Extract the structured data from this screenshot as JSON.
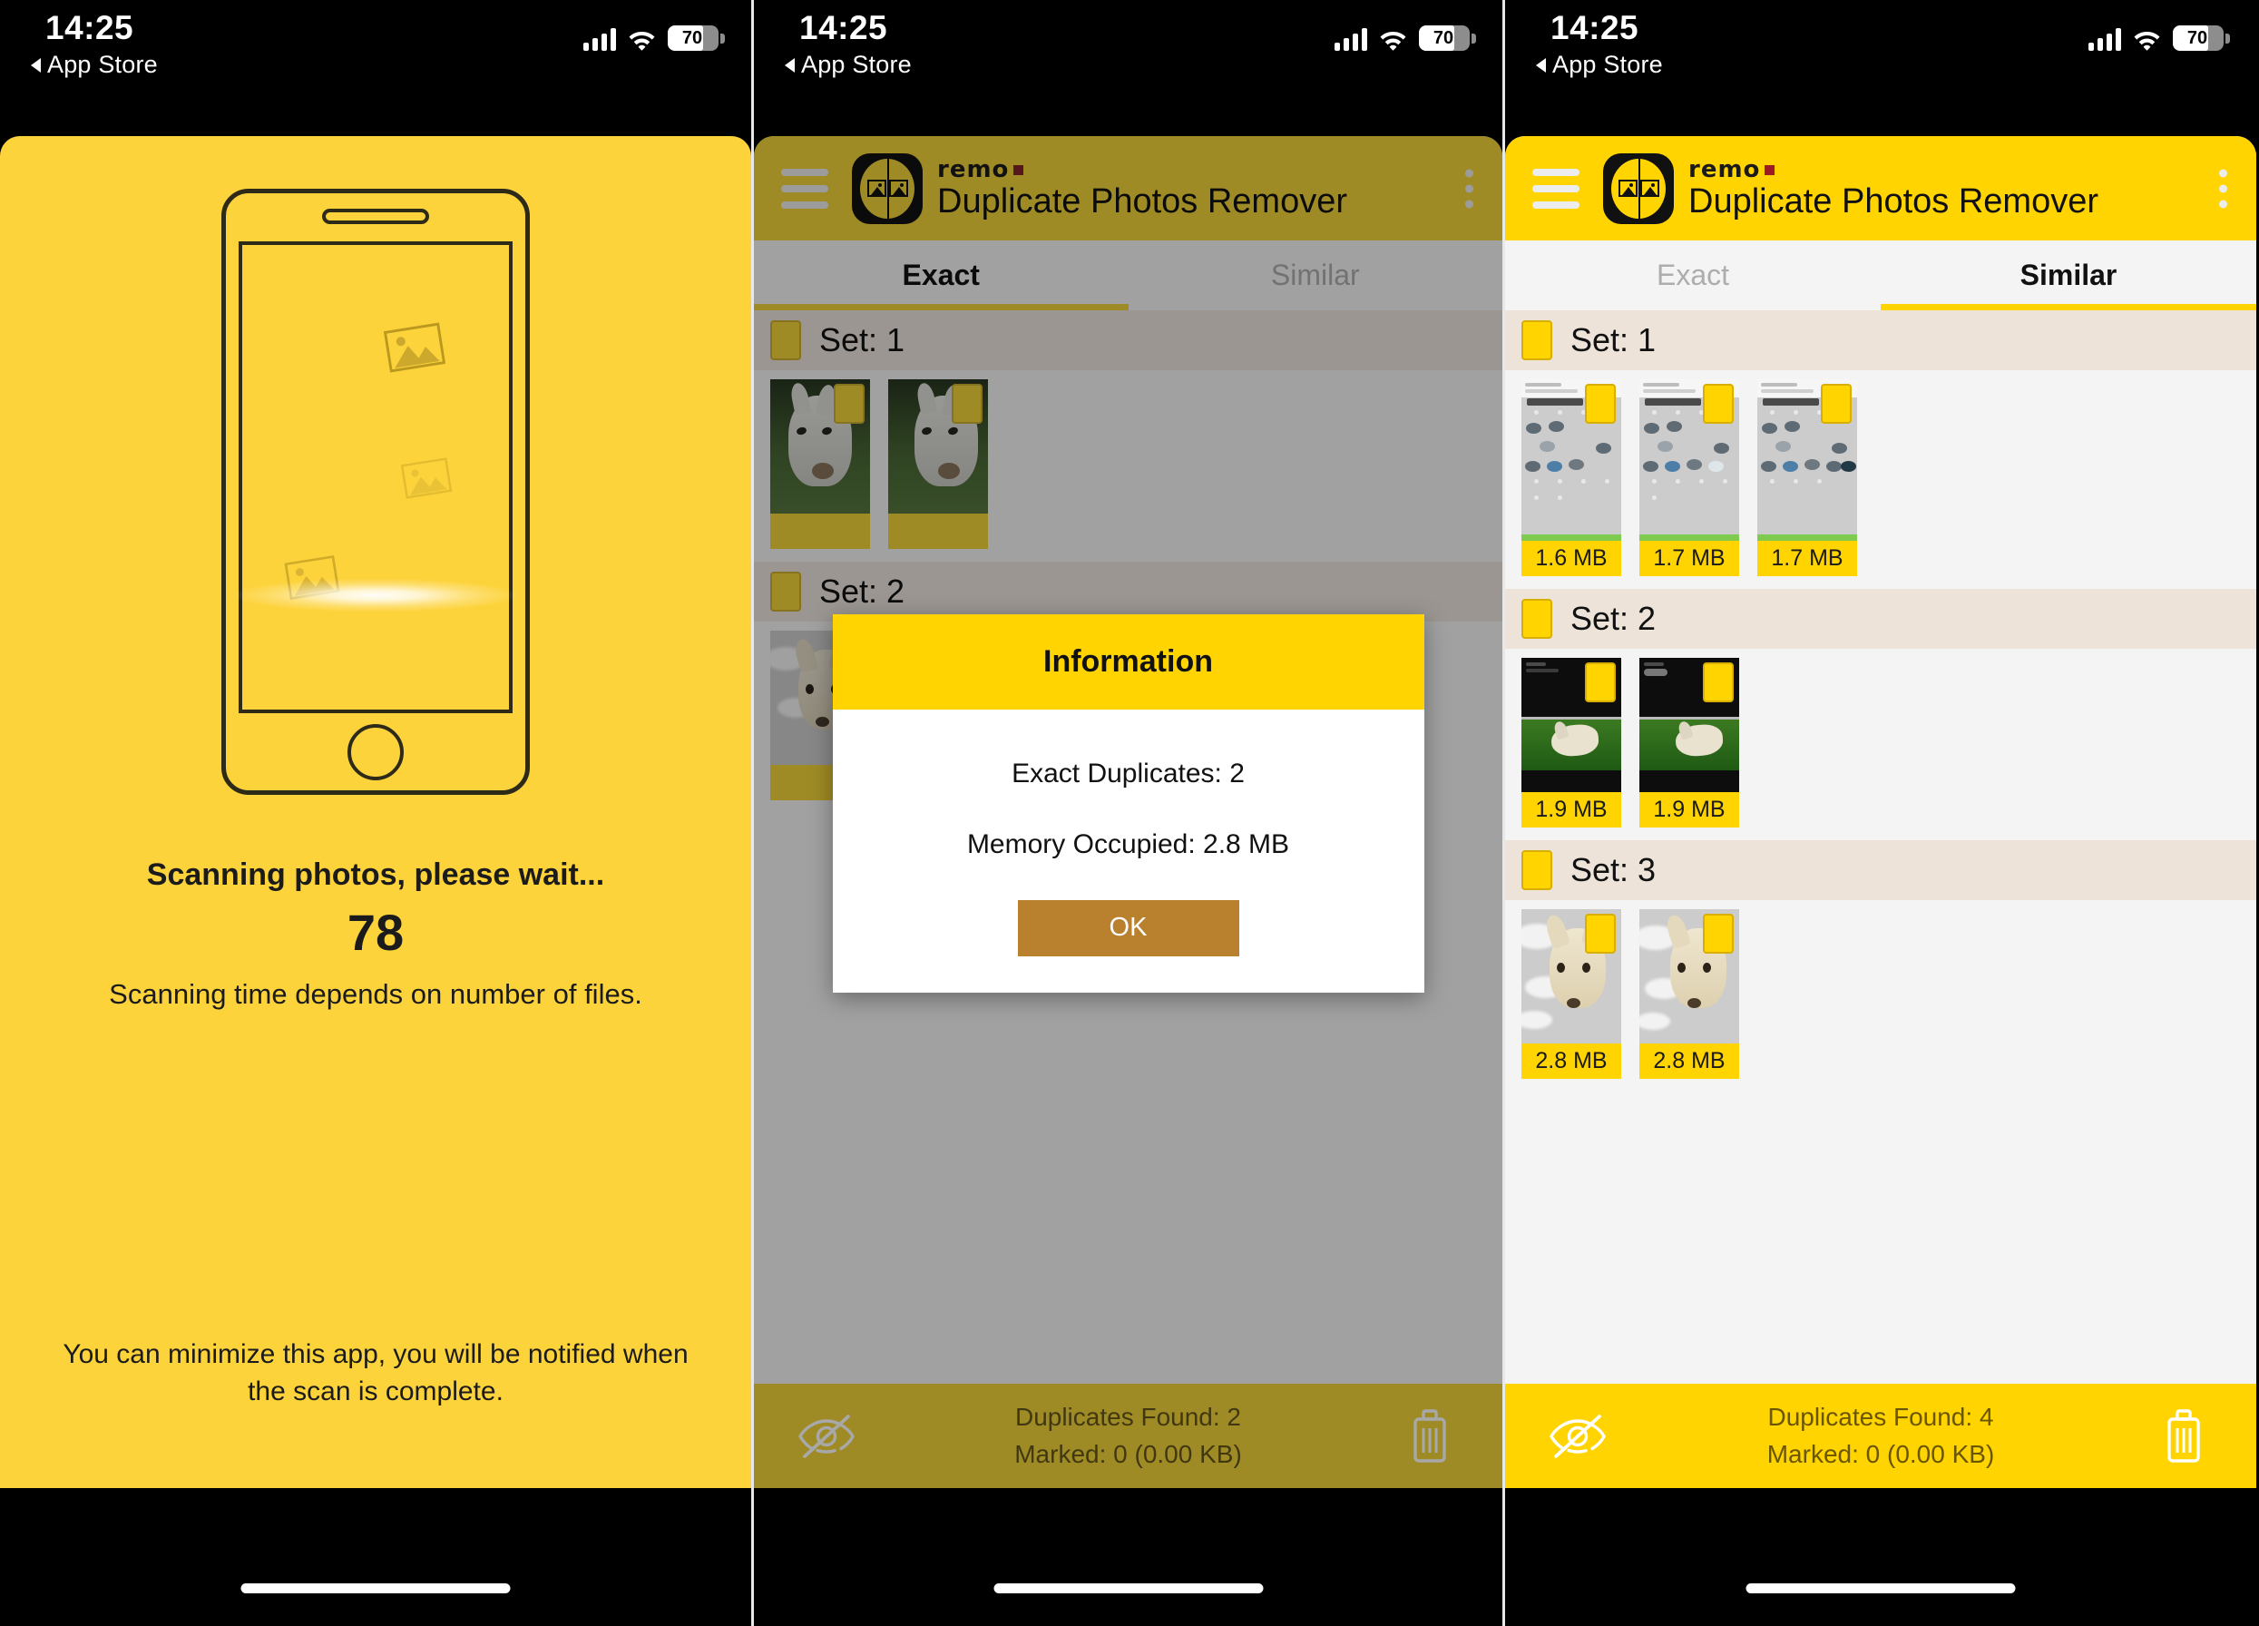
{
  "colors": {
    "brand_yellow": "#FFD400",
    "scan_yellow": "#FDD33C",
    "set_header_bg": "#EDE3D8",
    "list_bg": "#F4F4F4",
    "ok_button": "#B9802E",
    "remo_dot": "#9E1B25"
  },
  "status_bar": {
    "time": "14:25",
    "back_label": "App Store",
    "back_icon": "triangle-left-icon",
    "signal_icon": "cellular-signal-icon",
    "wifi_icon": "wifi-icon",
    "battery_icon": "battery-icon",
    "battery_level": "70"
  },
  "panel1": {
    "illustration": {
      "name": "phone-scanning-illustration",
      "photo_icon": "image-placeholder-icon",
      "beam": "scan-beam"
    },
    "scanning_title": "Scanning photos, please wait...",
    "scanned_count": "78",
    "scanning_subtitle": "Scanning time depends on number of files.",
    "footer_note": "You can minimize this app, you will be notified when the scan is complete."
  },
  "app": {
    "menu_icon": "hamburger-menu-icon",
    "logo_icon": "remo-app-logo-icon",
    "brand": "remo",
    "title": "Duplicate Photos Remover",
    "overflow_icon": "kebab-menu-icon",
    "tabs": [
      {
        "label": "Exact"
      },
      {
        "label": "Similar"
      }
    ]
  },
  "panel2": {
    "active_tab": "Exact",
    "sets": [
      {
        "label": "Set: 1",
        "thumbs": [
          {
            "size": "",
            "art": "donkey"
          },
          {
            "size": "",
            "art": "donkey"
          }
        ]
      },
      {
        "label": "Set: 2",
        "thumbs": [
          {
            "size": "",
            "art": "dog-sky"
          },
          {
            "size": "",
            "art": "dog-sky"
          }
        ]
      }
    ],
    "bottom_bar": {
      "hide_icon": "eye-slash-icon",
      "duplicates_found": "Duplicates Found: 2",
      "marked": "Marked: 0 (0.00 KB)",
      "delete_icon": "trash-icon"
    },
    "dialog": {
      "title": "Information",
      "line1": "Exact Duplicates: 2",
      "line2": "Memory Occupied: 2.8 MB",
      "ok_label": "OK"
    }
  },
  "panel3": {
    "active_tab": "Similar",
    "sets": [
      {
        "label": "Set: 1",
        "thumbs": [
          {
            "size": "1.6 MB",
            "art": "screenshot"
          },
          {
            "size": "1.7 MB",
            "art": "screenshot"
          },
          {
            "size": "1.7 MB",
            "art": "screenshot"
          }
        ]
      },
      {
        "label": "Set: 2",
        "thumbs": [
          {
            "size": "1.9 MB",
            "art": "dog-grass"
          },
          {
            "size": "1.9 MB",
            "art": "dog-grass"
          }
        ]
      },
      {
        "label": "Set: 3",
        "thumbs": [
          {
            "size": "2.8 MB",
            "art": "dog-sky"
          },
          {
            "size": "2.8 MB",
            "art": "dog-sky"
          }
        ]
      }
    ],
    "bottom_bar": {
      "hide_icon": "eye-slash-icon",
      "duplicates_found": "Duplicates Found: 4",
      "marked": "Marked: 0 (0.00 KB)",
      "delete_icon": "trash-icon"
    }
  }
}
